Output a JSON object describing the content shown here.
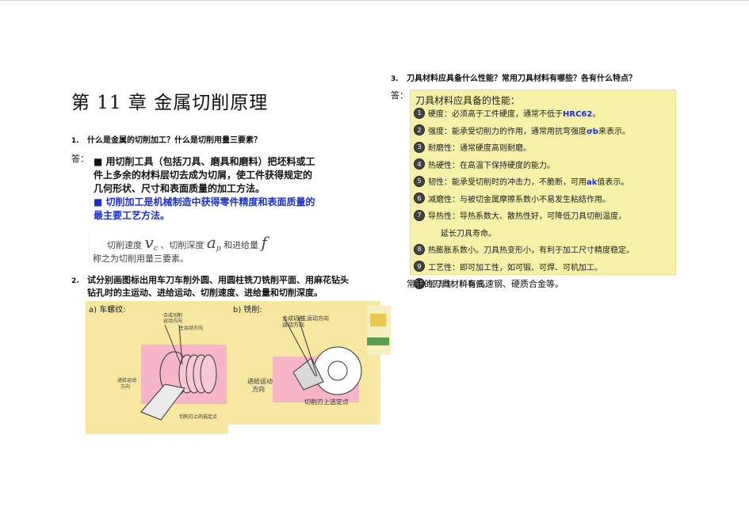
{
  "chapter": {
    "title": "第 11 章  金属切削原理"
  },
  "q1": {
    "num": "1.",
    "text": "什么是金属的切削加工？什么是切削用量三要素？",
    "answer_label": "答：",
    "bullet1": "■ 用切削工具（包括刀具、磨具和磨料）把坯料或工件上多余的材料层切去成为切屑，使工件获得规定的几何形状、尺寸和表面质量的加工方法。",
    "bullet1_line1": "■ 用切削工具（包括刀具、磨具和磨料）把坯料或工",
    "bullet1_line2": "件上多余的材料层切去成为切屑，使工件获得规定的",
    "bullet1_line3": "几何形状、尺寸和表面质量的加工方法。",
    "bullet2_line1": "■ 切削加工是机械制造中获得零件精度和表面质量的",
    "bullet2_line2": "最主要工艺方法。",
    "formula": {
      "part1": "切削速度",
      "vc": "v",
      "vc_sub": "c",
      "part2": "、切削深度",
      "ap": "a",
      "ap_sub": "p",
      "part3": "和进给量",
      "f": "f",
      "line2": "称之为切削用量三要素。"
    }
  },
  "q2": {
    "num": "2.",
    "line1": "试分别画图标出用车刀车削外圆、用圆柱铣刀铣削平面、用麻花钻头",
    "line2": "钻孔时的主运动、进给运动、切削速度、进给量和切削深度。",
    "fig_a_label": "a) 车螺纹:",
    "fig_b_label": "b) 铣削:",
    "fig_a_labels": [
      "合成切削",
      "运动方向",
      "主运动方向",
      "进给运动",
      "方向",
      "切削刃上的选定点"
    ],
    "fig_b_labels": [
      "合成切削",
      "运动方向",
      "主运动方向",
      "进给运动",
      "方向",
      "切削刃上选定点"
    ]
  },
  "q3": {
    "num": "3.",
    "text": "刀具材料应具备什么性能？常用刀具材料有哪些？各有什么特点？",
    "answer_label": "答：",
    "panel_title": "刀具材料应具备的性能：",
    "properties": [
      {
        "n": "1",
        "text": "硬度：必须高于工件硬度，通常不低于",
        "hl": "HRC62",
        "after": "。"
      },
      {
        "n": "2",
        "text": "强度：能承受切削力的作用，通常用抗弯强度",
        "hl": "σb",
        "after": "来表示。"
      },
      {
        "n": "3",
        "text": "耐磨性：通常硬度高则耐磨。",
        "hl": "",
        "after": ""
      },
      {
        "n": "4",
        "text": "热硬性：在高温下保持硬度的能力。",
        "hl": "",
        "after": ""
      },
      {
        "n": "5",
        "text": "韧性：能承受切削时的冲击力，不脆断，可用",
        "hl": "ak",
        "after": "值表示。"
      },
      {
        "n": "6",
        "text": "减磨性：与被切金属摩擦系数小不易发生粘结作用。",
        "hl": "",
        "after": ""
      },
      {
        "n": "7",
        "text": "导热性：导热系数大、散热性好，可降低刀具切削温度，",
        "hl": "",
        "after": ""
      },
      {
        "n": "",
        "text": "延长刀具寿命。",
        "hl": "",
        "after": ""
      },
      {
        "n": "8",
        "text": "热膨胀系数小。刀具热变形小，有利于加工尺寸精度稳定。",
        "hl": "",
        "after": ""
      },
      {
        "n": "9",
        "text": "工艺性：即可加工性，如可锻、可焊、可机加工。",
        "hl": "",
        "after": ""
      },
      {
        "n": "10",
        "text": "经济性：价格低。",
        "hl": "",
        "after": ""
      }
    ],
    "common_materials": "常用的刀具材料有高速钢、硬质合金等。"
  }
}
